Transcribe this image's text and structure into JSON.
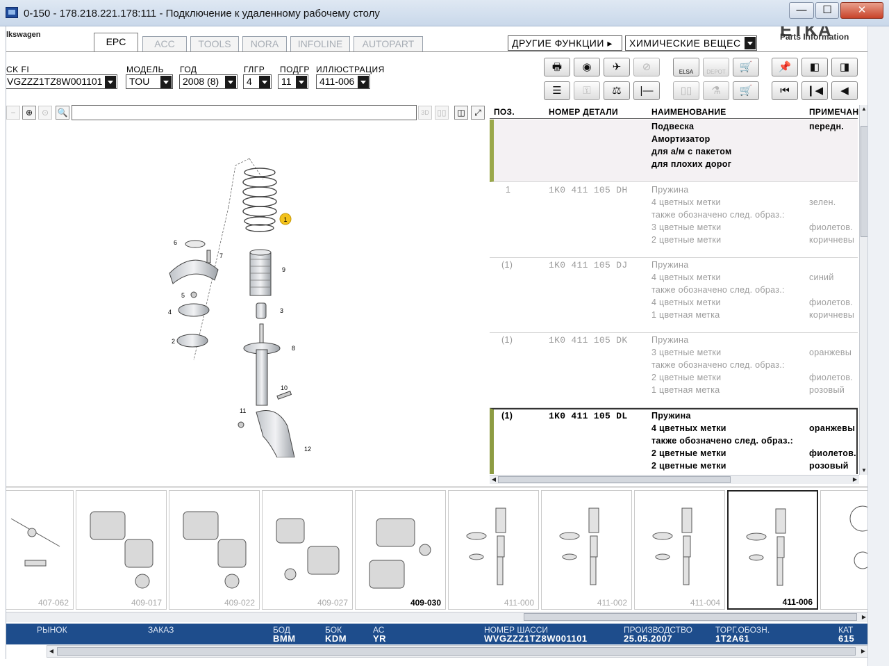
{
  "window": {
    "title": "0-150 - 178.218.221.178:111 - Подключение к удаленному рабочему столу",
    "minimize_glyph": "—",
    "maximize_glyph": "☐",
    "close_glyph": "✕"
  },
  "brand": {
    "make": "lkswagen",
    "product_top": "ETKA",
    "product": "Parts Information"
  },
  "tabs": [
    "EPC",
    "ACC",
    "TOOLS",
    "NORA",
    "INFOLINE",
    "AUTOPART"
  ],
  "other_functions": {
    "label": "ДРУГИЕ ФУНКЦИИ ▸",
    "select_value": "ХИМИЧЕСКИЕ ВЕЩЕС"
  },
  "filters": [
    {
      "label": "CK FI",
      "value": "VGZZZ1TZ8W001101"
    },
    {
      "label": "МОДЕЛЬ",
      "value": "TOU"
    },
    {
      "label": "ГОД",
      "value": "2008 (8)"
    },
    {
      "label": "ГЛГР",
      "value": "4"
    },
    {
      "label": "ПОДГР",
      "value": "11"
    },
    {
      "label": "ИЛЛЮСТРАЦИЯ",
      "value": "411-006"
    }
  ],
  "toolbar": {
    "row1": [
      "🖶",
      "◉",
      "✈",
      "⊘",
      "ELSA",
      "DEPOT",
      "🛒",
      "📌",
      "◧",
      "◨"
    ],
    "row2": [
      "☰",
      "⚿",
      "⚖",
      "|—",
      "▯▯",
      "⚗",
      "🛒",
      "⏮",
      "❙◀",
      "◀"
    ]
  },
  "panel_tools": [
    "−",
    "⊕",
    "⊙",
    "🔍"
  ],
  "panel_tools_right": [
    "3D",
    "▯▯",
    "◫",
    "⤢"
  ],
  "table": {
    "columns": [
      "ПОЗ.",
      "НОМЕР ДЕТАЛИ",
      "НАИМЕНОВАНИЕ",
      "ПРИМЕЧАНИЕ"
    ],
    "header_lines": [
      "Подвеска",
      "Амортизатор",
      "для а/м с пакетом",
      "для плохих дорог"
    ],
    "header_note": "передн.",
    "rows": [
      {
        "pos": "1",
        "part": "1K0  411  105  DH",
        "lines": [
          {
            "name": "Пружина",
            "note": ""
          },
          {
            "name": "4 цветных метки",
            "note": "зелен."
          },
          {
            "name": "также обозначено след. образ.:",
            "note": ""
          },
          {
            "name": "3 цветные метки",
            "note": "фиолетов."
          },
          {
            "name": "2 цветные метки",
            "note": "коричневы"
          }
        ]
      },
      {
        "pos": "(1)",
        "part": "1K0  411  105  DJ",
        "lines": [
          {
            "name": "Пружина",
            "note": ""
          },
          {
            "name": "4 цветных метки",
            "note": "синий"
          },
          {
            "name": "также обозначено след. образ.:",
            "note": ""
          },
          {
            "name": "4 цветных метки",
            "note": "фиолетов."
          },
          {
            "name": "1 цветная метка",
            "note": "коричневы"
          }
        ]
      },
      {
        "pos": "(1)",
        "part": "1K0  411  105  DK",
        "lines": [
          {
            "name": "Пружина",
            "note": ""
          },
          {
            "name": "3 цветные метки",
            "note": "оранжевы"
          },
          {
            "name": "также обозначено след. образ.:",
            "note": ""
          },
          {
            "name": "2 цветные метки",
            "note": "фиолетов."
          },
          {
            "name": "1 цветная метка",
            "note": "розовый"
          }
        ]
      },
      {
        "pos": "(1)",
        "part": "1K0  411  105  DL",
        "lines": [
          {
            "name": "Пружина",
            "note": ""
          },
          {
            "name": "4 цветных метки",
            "note": "оранжевы"
          },
          {
            "name": "также обозначено след. образ.:",
            "note": ""
          },
          {
            "name": "2 цветные метки",
            "note": "фиолетов."
          },
          {
            "name": "2 цветные метки",
            "note": "розовый"
          }
        ]
      }
    ]
  },
  "diagram_callouts": [
    "1",
    "2",
    "3",
    "4",
    "5",
    "6",
    "7",
    "8",
    "9",
    "10",
    "11",
    "12"
  ],
  "thumbnails": [
    "407-062",
    "409-017",
    "409-022",
    "409-027",
    "409-030",
    "411-000",
    "411-002",
    "411-004",
    "411-006"
  ],
  "status": [
    {
      "label": "РЫНОК",
      "value": ""
    },
    {
      "label": "ЗАКАЗ",
      "value": ""
    },
    {
      "label": "БОД",
      "value": "BMM"
    },
    {
      "label": "БОК",
      "value": "KDM"
    },
    {
      "label": "АС",
      "value": "YR"
    },
    {
      "label": "НОМЕР ШАССИ",
      "value": "WVGZZZ1TZ8W001101"
    },
    {
      "label": "ПРОИЗВОДСТВО",
      "value": "25.05.2007"
    },
    {
      "label": "ТОРГ.ОБОЗН.",
      "value": "1T2A61"
    },
    {
      "label": "КАТ",
      "value": "615"
    }
  ],
  "colors": {
    "status_bg": "#1e4d8c",
    "accent_bar": "#9aa84a",
    "callout": "#f3c21b"
  }
}
